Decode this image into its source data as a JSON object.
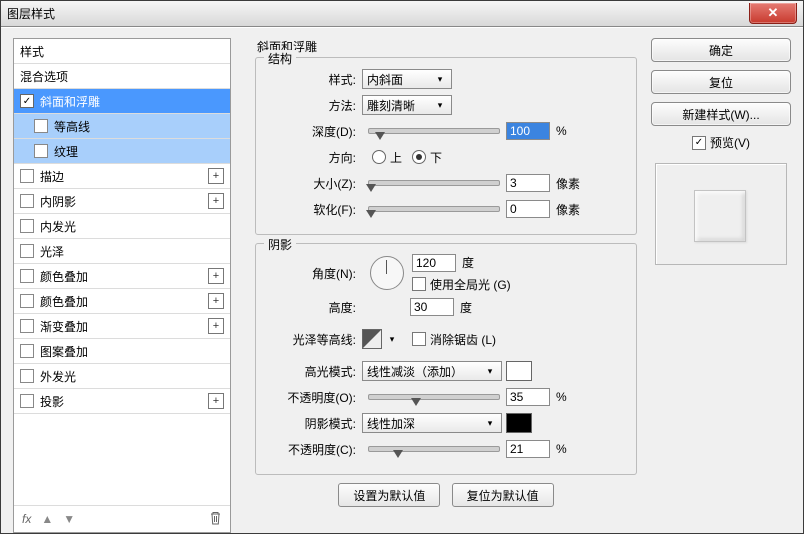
{
  "window": {
    "title": "图层样式"
  },
  "left": {
    "header": "样式",
    "blend": "混合选项",
    "items": [
      {
        "label": "斜面和浮雕",
        "checked": true,
        "selected": true,
        "plus": false,
        "indent": 0
      },
      {
        "label": "等高线",
        "checked": false,
        "selected": false,
        "plus": false,
        "indent": 1,
        "sub": true
      },
      {
        "label": "纹理",
        "checked": false,
        "selected": false,
        "plus": false,
        "indent": 1,
        "sub": true
      },
      {
        "label": "描边",
        "checked": false,
        "plus": true
      },
      {
        "label": "内阴影",
        "checked": false,
        "plus": true
      },
      {
        "label": "内发光",
        "checked": false,
        "plus": false
      },
      {
        "label": "光泽",
        "checked": false,
        "plus": false
      },
      {
        "label": "颜色叠加",
        "checked": false,
        "plus": true
      },
      {
        "label": "颜色叠加",
        "checked": false,
        "plus": true
      },
      {
        "label": "渐变叠加",
        "checked": false,
        "plus": true
      },
      {
        "label": "图案叠加",
        "checked": false,
        "plus": false
      },
      {
        "label": "外发光",
        "checked": false,
        "plus": false
      },
      {
        "label": "投影",
        "checked": false,
        "plus": true
      }
    ],
    "footer": {
      "fx": "fx"
    }
  },
  "middle": {
    "title": "斜面和浮雕",
    "structure": {
      "label": "结构",
      "style": {
        "lbl": "样式:",
        "value": "内斜面"
      },
      "method": {
        "lbl": "方法:",
        "value": "雕刻清晰"
      },
      "depth": {
        "lbl": "深度(D):",
        "value": "100",
        "unit": "%"
      },
      "direction": {
        "lbl": "方向:",
        "up": "上",
        "down": "下"
      },
      "size": {
        "lbl": "大小(Z):",
        "value": "3",
        "unit": "像素"
      },
      "soften": {
        "lbl": "软化(F):",
        "value": "0",
        "unit": "像素"
      }
    },
    "shading": {
      "label": "阴影",
      "angle": {
        "lbl": "角度(N):",
        "value": "120",
        "unit": "度"
      },
      "global": {
        "label": "使用全局光 (G)"
      },
      "altitude": {
        "lbl": "高度:",
        "value": "30",
        "unit": "度"
      },
      "gloss": {
        "lbl": "光泽等高线:"
      },
      "antialias": {
        "label": "消除锯齿 (L)"
      },
      "highlight_mode": {
        "lbl": "高光模式:",
        "value": "线性减淡（添加）"
      },
      "highlight_opacity": {
        "lbl": "不透明度(O):",
        "value": "35",
        "unit": "%"
      },
      "shadow_mode": {
        "lbl": "阴影模式:",
        "value": "线性加深"
      },
      "shadow_opacity": {
        "lbl": "不透明度(C):",
        "value": "21",
        "unit": "%"
      }
    },
    "buttons": {
      "make_default": "设置为默认值",
      "reset_default": "复位为默认值"
    }
  },
  "right": {
    "ok": "确定",
    "reset": "复位",
    "new_style": "新建样式(W)...",
    "preview": "预览(V)"
  }
}
